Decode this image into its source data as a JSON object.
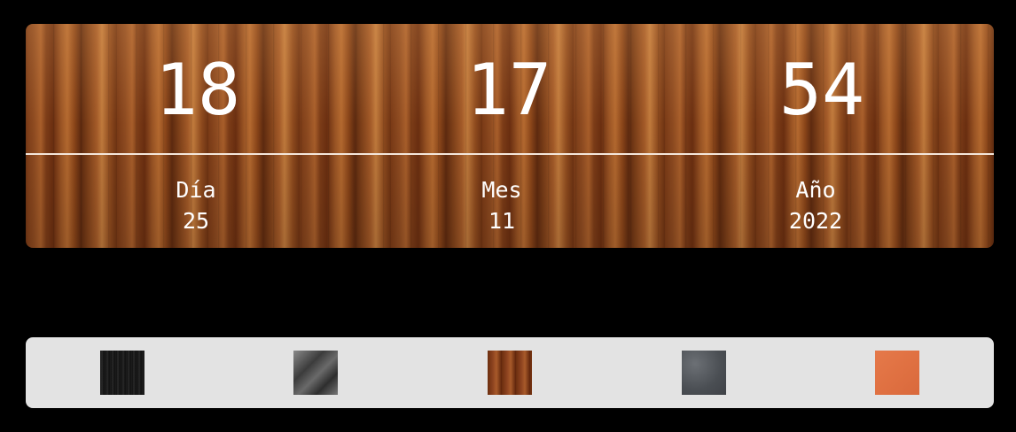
{
  "clock": {
    "hours": "18",
    "minutes": "17",
    "seconds": "54"
  },
  "date": {
    "day_label": "Día",
    "day_value": "25",
    "month_label": "Mes",
    "month_value": "11",
    "year_label": "Año",
    "year_value": "2022"
  },
  "themes": [
    {
      "name": "black-stripes"
    },
    {
      "name": "grey-stone"
    },
    {
      "name": "wood"
    },
    {
      "name": "granite"
    },
    {
      "name": "orange"
    }
  ],
  "colors": {
    "page_background": "#000000",
    "theme_bar_background": "#e3e3e3",
    "digit_color": "#ffffff",
    "divider_color": "#f4e6da"
  }
}
